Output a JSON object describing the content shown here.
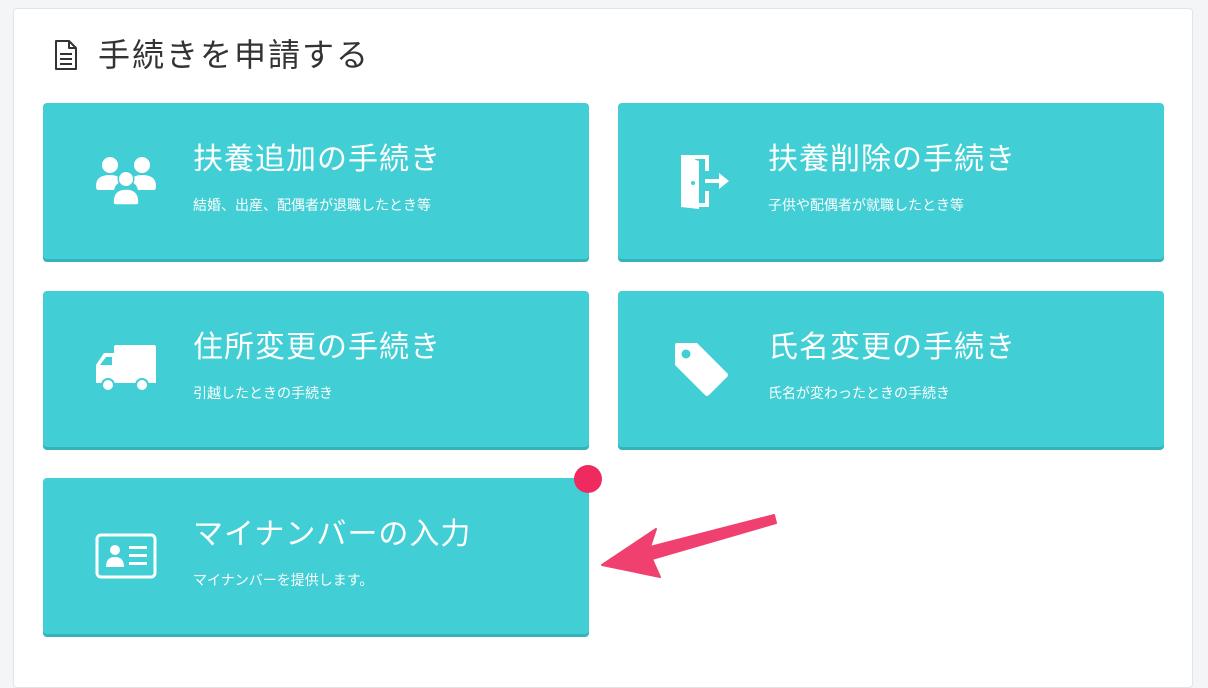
{
  "panel": {
    "title": "手続きを申請する",
    "title_icon": "document-icon"
  },
  "cards": [
    {
      "icon": "users-icon",
      "title": "扶養追加の手続き",
      "subtitle": "結婚、出産、配偶者が退職したとき等"
    },
    {
      "icon": "door-exit-icon",
      "title": "扶養削除の手続き",
      "subtitle": "子供や配偶者が就職したとき等"
    },
    {
      "icon": "truck-icon",
      "title": "住所変更の手続き",
      "subtitle": "引越したときの手続き"
    },
    {
      "icon": "tag-icon",
      "title": "氏名変更の手続き",
      "subtitle": "氏名が変わったときの手続き"
    },
    {
      "icon": "id-card-icon",
      "title": "マイナンバーの入力",
      "subtitle": "マイナンバーを提供します。",
      "has_notification": true
    }
  ],
  "colors": {
    "card_background": "#41cfd5",
    "notification_dot": "#ef2a5f",
    "arrow": "#f0406f"
  }
}
